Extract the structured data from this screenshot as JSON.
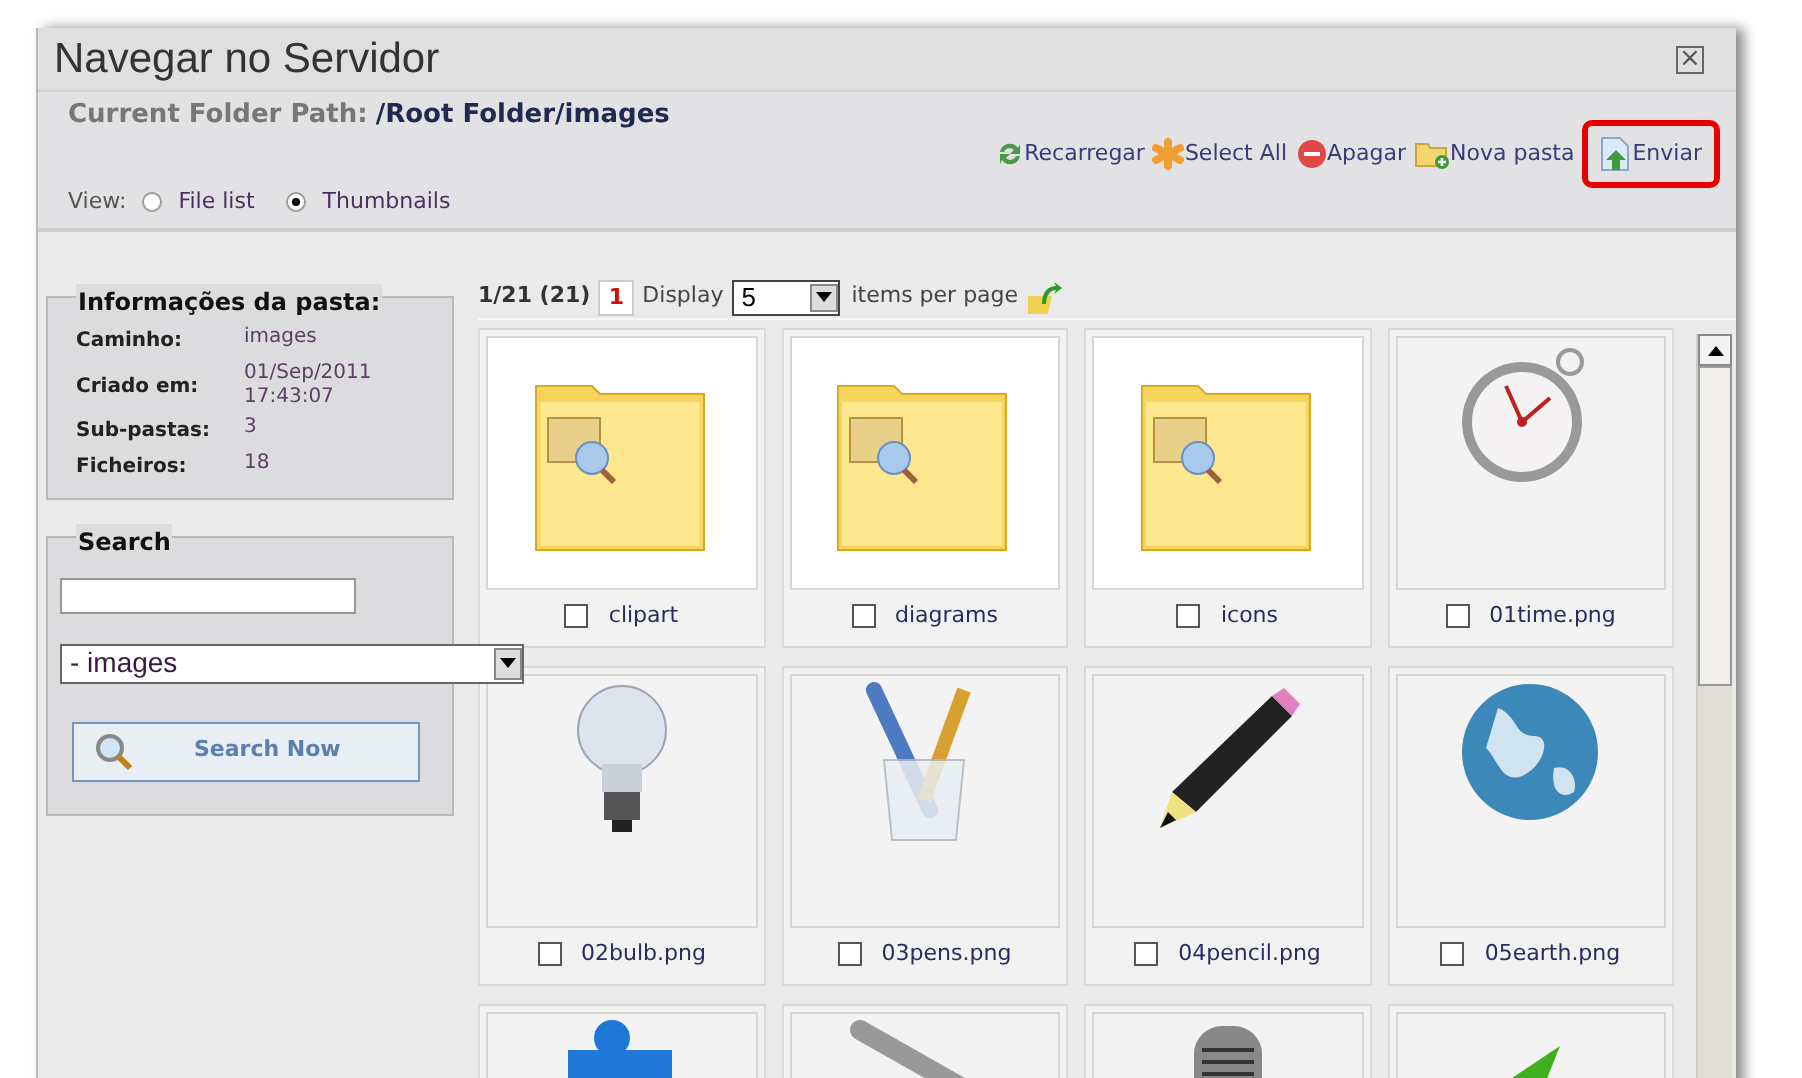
{
  "window": {
    "title": "Navegar no Servidor",
    "close_label": "×"
  },
  "path": {
    "label": "Current Folder Path:",
    "value": "/Root Folder/images"
  },
  "toolbar": [
    {
      "label": "Recarregar",
      "kind": "reload",
      "highlighted": false
    },
    {
      "label": "Select All",
      "kind": "select",
      "highlighted": false
    },
    {
      "label": "Apagar",
      "kind": "delete",
      "highlighted": false
    },
    {
      "label": "Nova pasta",
      "kind": "folder",
      "highlighted": false
    },
    {
      "label": "Enviar",
      "kind": "upload",
      "highlighted": true
    }
  ],
  "view": {
    "label": "View:",
    "options": [
      {
        "label": "File list",
        "selected": false
      },
      {
        "label": "Thumbnails",
        "selected": true
      }
    ]
  },
  "folder_info": {
    "title": "Informações da pasta:",
    "rows": [
      {
        "label": "Caminho:",
        "value": "images"
      },
      {
        "label": "Criado em:",
        "value": "01/Sep/2011 17:43:07"
      },
      {
        "label": "Sub-pastas:",
        "value": "3"
      },
      {
        "label": "Ficheiros:",
        "value": "18"
      }
    ]
  },
  "search": {
    "title": "Search",
    "folder": "- images",
    "button": "Search Now"
  },
  "pager": {
    "summary": "1/21 (21)",
    "page": "1",
    "display_label": "Display",
    "per_page": "5",
    "per_page_label": "items per page"
  },
  "items": [
    {
      "kind": "folder",
      "name": "clipart",
      "checked": false
    },
    {
      "kind": "folder",
      "name": "diagrams",
      "checked": false
    },
    {
      "kind": "folder",
      "name": "icons",
      "checked": false
    },
    {
      "kind": "image",
      "name": "01time.png",
      "checked": false
    },
    {
      "kind": "image",
      "name": "02bulb.png",
      "checked": false
    },
    {
      "kind": "image",
      "name": "03pens.png",
      "checked": false
    },
    {
      "kind": "image",
      "name": "04pencil.png",
      "checked": false
    },
    {
      "kind": "image",
      "name": "05earth.png",
      "checked": false
    },
    {
      "kind": "image"
    },
    {
      "kind": "image"
    },
    {
      "kind": "image"
    },
    {
      "kind": "image"
    }
  ]
}
